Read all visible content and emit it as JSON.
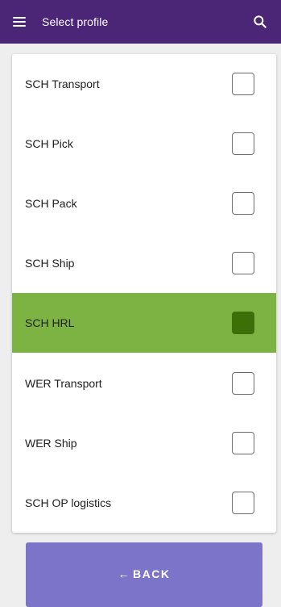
{
  "appbar": {
    "title": "Select profile",
    "menu_icon": "hamburger-menu-icon",
    "search_icon": "search-icon",
    "background": "#4b2576"
  },
  "profiles": [
    {
      "label": "SCH Transport",
      "checked": false
    },
    {
      "label": "SCH Pick",
      "checked": false
    },
    {
      "label": "SCH Pack",
      "checked": false
    },
    {
      "label": "SCH Ship",
      "checked": false
    },
    {
      "label": "SCH HRL",
      "checked": true
    },
    {
      "label": "WER Transport",
      "checked": false
    },
    {
      "label": "WER Ship",
      "checked": false
    },
    {
      "label": "SCH OP logistics",
      "checked": false
    }
  ],
  "colors": {
    "selected_row": "#7cb342",
    "selected_checkbox": "#3c6f08",
    "back_button": "#7c74c9"
  },
  "back_button": {
    "arrow": "←",
    "label": "BACK"
  }
}
